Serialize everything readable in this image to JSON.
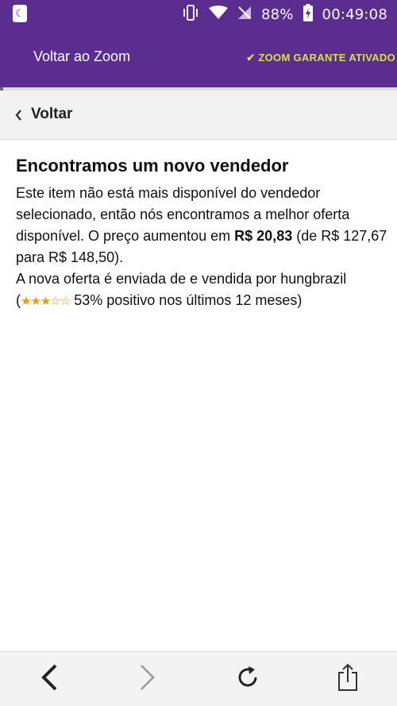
{
  "statusbar": {
    "battery_pct": "88%",
    "time": "00:49:08",
    "icons": [
      "moon-icon",
      "vibrate-icon",
      "wifi-icon",
      "no-signal-icon",
      "battery-charging-icon"
    ]
  },
  "zoombar": {
    "back_label": "Voltar ao Zoom",
    "guarantee_label": "ZOOM GARANTE ATIVADO",
    "guarantee_icon": "check-icon",
    "accent": "#5c2d91",
    "guarantee_color": "#d8e04a"
  },
  "nav": {
    "back_label": "Voltar"
  },
  "content": {
    "title": "Encontramos um novo vendedor",
    "p1_pre": "Este item não está mais disponível do vendedor selecionado, então nós encontramos a melhor oferta disponível. O preço aumentou em ",
    "p1_bold": "R$ 20,83",
    "p1_post": " (de R$ 127,67 para R$ 148,50).",
    "p2_pre": "A nova oferta é enviada de e vendida por hungbrazil (",
    "rating": {
      "filled": 3,
      "total": 5
    },
    "p2_post": " 53% positivo nos últimos 12 meses)"
  },
  "bottombar": {
    "icons": [
      "back-arrow-icon",
      "forward-arrow-icon",
      "reload-icon",
      "share-icon"
    ]
  }
}
